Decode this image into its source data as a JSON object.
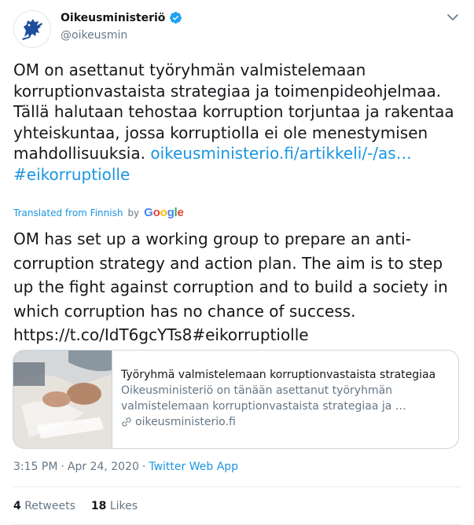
{
  "author": {
    "display_name": "Oikeusministeriö",
    "handle": "@oikeusmin",
    "verified_icon": "verified-badge-icon"
  },
  "tweet": {
    "text_plain": "OM on asettanut työryhmän valmistelemaan korruptionvastaista strategiaa ja toimenpideohjelmaa. Tällä halutaan tehostaa korruption torjuntaa ja rakentaa yhteiskuntaa, jossa korruptiolla ei ole menestymisen mahdollisuuksia. ",
    "link": "oikeusministerio.fi/artikkeli/-/as…",
    "hashtag": "#eikorruptiolle"
  },
  "translation": {
    "label": "Translated from Finnish",
    "by": "by",
    "provider": "Google",
    "text_plain": "OM has set up a working group to prepare an anti-corruption strategy and action plan. The aim is to step up the fight against corruption and to build a society in which corruption has no chance of success. https://t.co/IdT6gcYTs8#eikorruptiolle"
  },
  "card": {
    "title": "Työryhmä valmistelemaan korruptionvastaista strategiaa",
    "description": "Oikeusministeriö on tänään asettanut työryhmän valmistelemaan korruptionvastaista strategiaa ja …",
    "domain": "oikeusministerio.fi"
  },
  "meta": {
    "time": "3:15 PM",
    "separator": "·",
    "date": "Apr 24, 2020",
    "source": "Twitter Web App"
  },
  "stats": {
    "retweets_count": "4",
    "retweets_label": "Retweets",
    "likes_count": "18",
    "likes_label": "Likes"
  },
  "colors": {
    "link": "#1b95e0",
    "text": "#14171a",
    "secondary": "#657786",
    "verified": "#1da1f2"
  }
}
